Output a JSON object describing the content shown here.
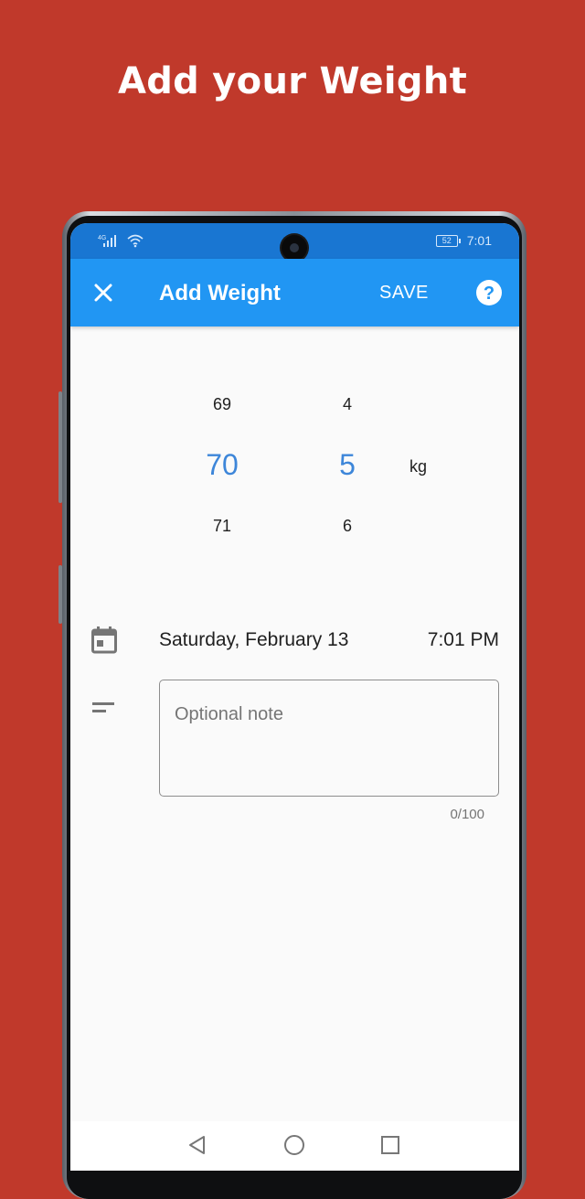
{
  "headline": "Add your Weight",
  "status_bar": {
    "network": "4G",
    "battery": "52",
    "time": "7:01"
  },
  "app_bar": {
    "title": "Add Weight",
    "save_label": "SAVE",
    "close_icon": "close-icon",
    "help_icon": "help-circle-icon"
  },
  "weight_picker": {
    "integer": {
      "above": "69",
      "selected": "70",
      "below": "71"
    },
    "decimal": {
      "above": "4",
      "selected": "5",
      "below": "6"
    },
    "unit": "kg"
  },
  "date_row": {
    "icon": "calendar-icon",
    "date": "Saturday, February 13",
    "time": "7:01 PM"
  },
  "note": {
    "icon": "notes-icon",
    "placeholder": "Optional note",
    "value": "",
    "counter": "0/100"
  },
  "colors": {
    "background": "#c0392b",
    "status_bar": "#1976d2",
    "app_bar": "#2196f3",
    "picker_accent": "#3d86d9"
  }
}
